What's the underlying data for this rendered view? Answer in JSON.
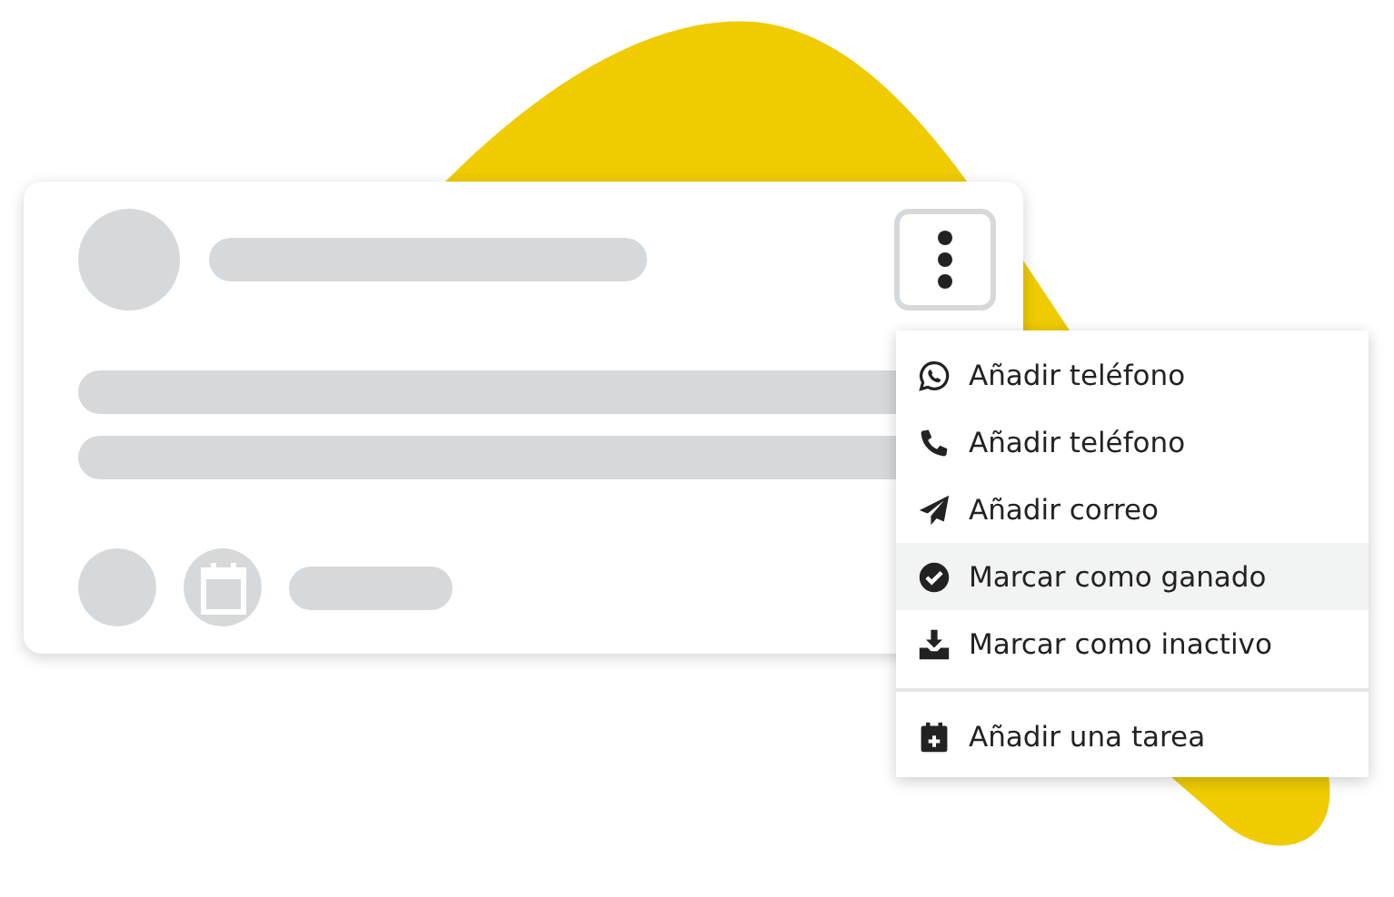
{
  "menu": {
    "sections": [
      [
        {
          "label": "Añadir teléfono",
          "selected": false
        },
        {
          "label": "Añadir teléfono",
          "selected": false
        },
        {
          "label": "Añadir correo",
          "selected": false
        },
        {
          "label": "Marcar como ganado",
          "selected": true
        },
        {
          "label": "Marcar como inactivo",
          "selected": false
        }
      ],
      [
        {
          "label": "Añadir una tarea",
          "selected": false
        }
      ]
    ]
  }
}
